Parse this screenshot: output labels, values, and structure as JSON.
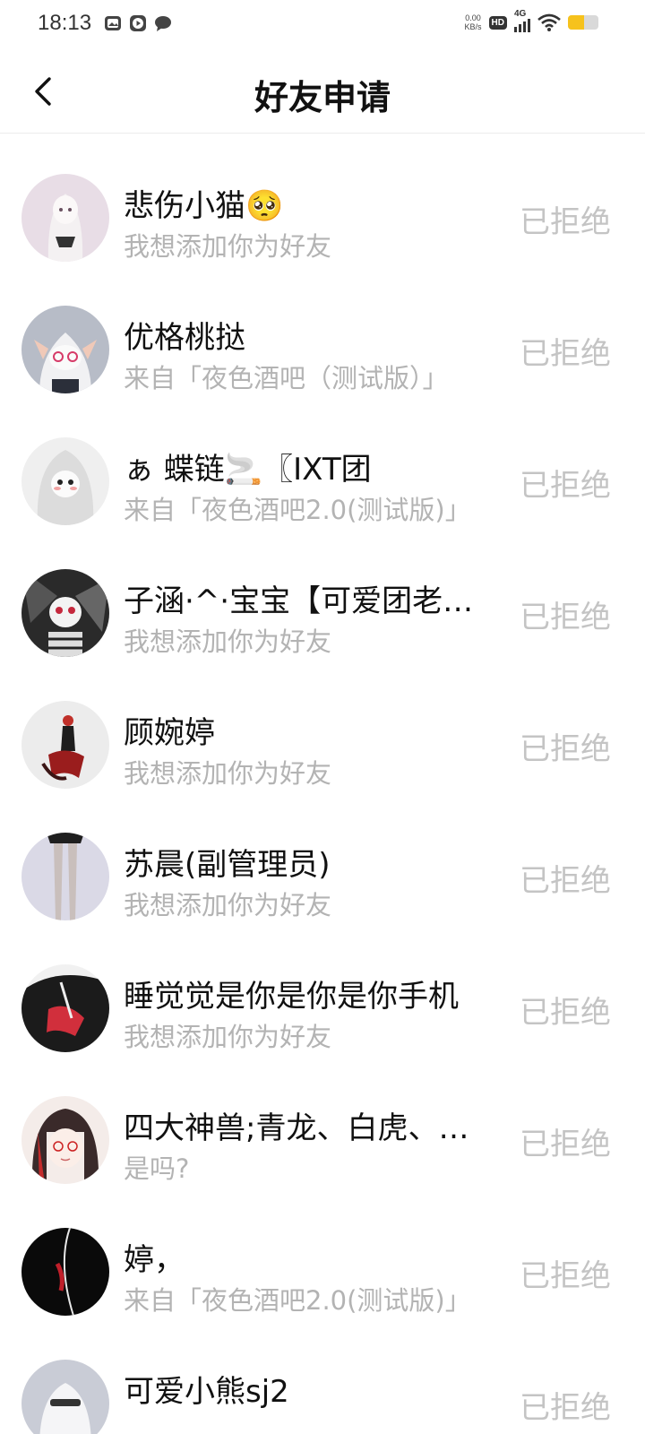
{
  "status_bar": {
    "time": "18:13",
    "net_speed_value": "0.00",
    "net_speed_unit": "KB/s",
    "hd_label": "HD",
    "network_label": "4G",
    "battery_level": 0.52,
    "icons": [
      "gallery-icon",
      "play-icon",
      "chat-bubble-icon",
      "wifi-icon",
      "battery-icon"
    ]
  },
  "header": {
    "title": "好友申请",
    "back_icon": "chevron-left-icon"
  },
  "colors": {
    "name_text": "#111111",
    "secondary_text": "#b3b3b3",
    "status_text": "#c4c4c4",
    "battery_fill": "#f6c21c"
  },
  "requests": [
    {
      "name": "悲伤小猫🥺",
      "message": "我想添加你为好友",
      "status": "已拒绝"
    },
    {
      "name": "优格桃挞",
      "message": "来自「夜色酒吧（测试版）」",
      "status": "已拒绝"
    },
    {
      "name": "ぁ 蝶链🚬〖IXT团",
      "message": "来自「夜色酒吧2.0(测试版)」",
      "status": "已拒绝"
    },
    {
      "name": "子涵·^·宝宝【可爱团老…",
      "message": "我想添加你为好友",
      "status": "已拒绝"
    },
    {
      "name": "顾婉婷",
      "message": "我想添加你为好友",
      "status": "已拒绝"
    },
    {
      "name": "苏晨(副管理员)",
      "message": "我想添加你为好友",
      "status": "已拒绝"
    },
    {
      "name": "睡觉觉是你是你是你手机",
      "message": "我想添加你为好友",
      "status": "已拒绝"
    },
    {
      "name": "四大神兽;青龙、白虎、…",
      "message": "是吗?",
      "status": "已拒绝"
    },
    {
      "name": "婷，",
      "message": "来自「夜色酒吧2.0(测试版)」",
      "status": "已拒绝"
    },
    {
      "name": "可爱小熊sj2",
      "message": "",
      "status": "已拒绝"
    }
  ]
}
